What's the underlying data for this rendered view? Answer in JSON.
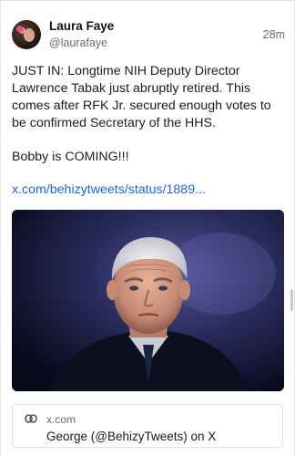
{
  "post": {
    "author_name": "Laura Faye",
    "author_handle": "@laurafaye",
    "timestamp": "28m",
    "paragraph1": "JUST IN: Longtime NIH Deputy Director Lawrence Tabak just abruptly retired. This comes after RFK Jr. secured enough votes to be confirmed Secretary of the HHS.",
    "paragraph2": "Bobby is COMING!!!",
    "link_text": "x.com/behizytweets/status/1889..."
  },
  "link_card": {
    "icon": "link-icon",
    "domain": "x.com",
    "title": "George (@BehizyTweets) on X"
  },
  "colors": {
    "link": "#1d64d6",
    "muted_text": "#6b6b6b",
    "card_border": "#e1e1e1"
  }
}
